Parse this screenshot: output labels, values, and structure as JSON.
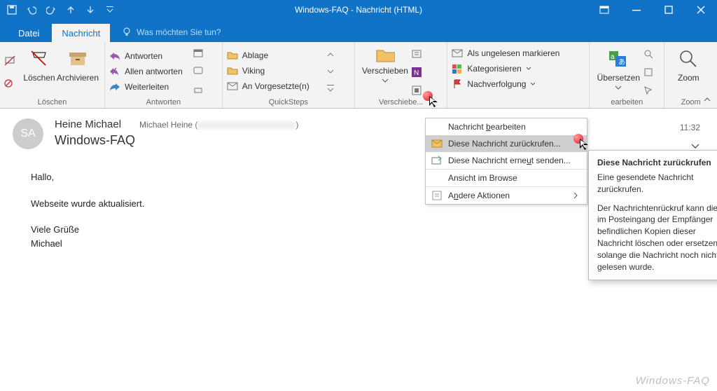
{
  "titlebar": {
    "title": "Windows-FAQ  -  Nachricht (HTML)"
  },
  "tabs": {
    "file": "Datei",
    "message": "Nachricht",
    "tellme": "Was möchten Sie tun?"
  },
  "ribbon": {
    "delete_group": "Löschen",
    "delete_split": "Löschen",
    "archive": "Archivieren",
    "respond_group": "Antworten",
    "reply": "Antworten",
    "reply_all": "Allen antworten",
    "forward": "Weiterleiten",
    "quicksteps_group": "QuickSteps",
    "qs_ablage": "Ablage",
    "qs_viking": "Viking",
    "qs_anvg": "An Vorgesetzte(n)",
    "move_group": "Verschiebe...",
    "move": "Verschieben",
    "tags_mark": "Als ungelesen markieren",
    "tags_categorize": "Kategorisieren",
    "tags_followup": "Nachverfolgung",
    "edit_group": "earbeiten",
    "translate": "Übersetzen",
    "zoom_group": "Zoom",
    "zoom": "Zoom"
  },
  "dropdown": {
    "edit_msg": "Nachricht bearbeiten",
    "recall": "Diese Nachricht zurückrufen...",
    "resend": "Diese Nachricht erneut senden...",
    "view_browser": "Ansicht im Browse",
    "other": "Andere Aktionen"
  },
  "tooltip": {
    "title": "Diese Nachricht zurückrufen",
    "p1": "Eine gesendete Nachricht zurückrufen.",
    "p2": "Der Nachrichtenrückruf kann die im Posteingang der Empfänger befindlichen Kopien dieser Nachricht löschen oder ersetzen, solange die Nachricht noch nicht gelesen wurde."
  },
  "message": {
    "avatar": "SA",
    "from": "Heine Michael",
    "recipient_prefix": "Michael Heine (",
    "recipient_suffix": ")",
    "subject": "Windows-FAQ",
    "time": "11:32",
    "body1": "Hallo,",
    "body2": "Webseite wurde aktualisiert.",
    "body3": "Viele Grüße",
    "body4": "Michael"
  },
  "watermark": "Windows-FAQ"
}
